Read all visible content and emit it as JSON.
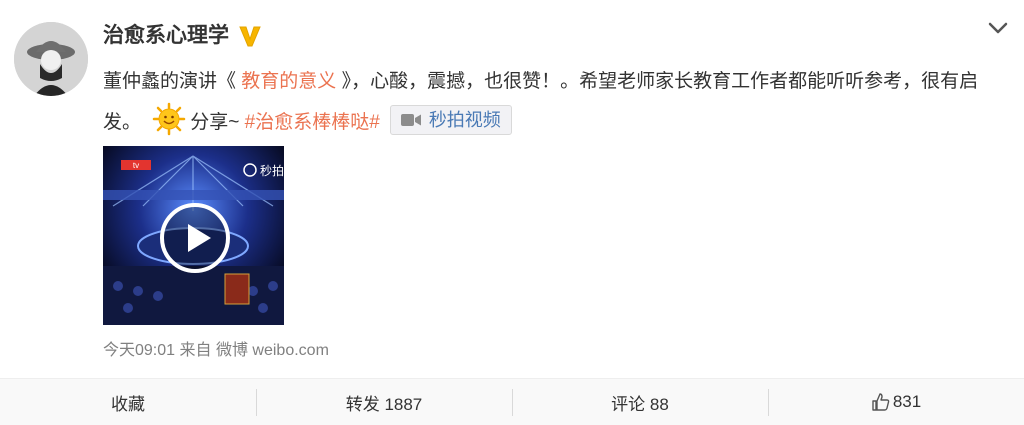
{
  "user": {
    "name": "治愈系心理学",
    "verified_badge": "V"
  },
  "post": {
    "text_start": "董仲蠡的演讲《 ",
    "link_text": "教育的意义",
    "text_mid": " 》，心酸，震撼，也很赞！。希望老师家长教育工作者都能听听参考，很有启发。",
    "emoji_name": "sun-emoji",
    "share_text": "分享~ ",
    "topic": "#治愈系棒棒哒#",
    "video_chip_label": "秒拍视频"
  },
  "video": {
    "logo_text": "秒拍",
    "channel_text": "tv",
    "play_icon": "play-icon"
  },
  "meta": {
    "time": "今天09:01",
    "source_prefix": "来自",
    "source": "微博 weibo.com"
  },
  "actions": {
    "favorite": "收藏",
    "repost": "转发 1887",
    "comment": "评论 88",
    "like_count": "831"
  },
  "colors": {
    "link": "#eb7350",
    "chip_text": "#4a7ab5",
    "verified": "#f7b500"
  }
}
